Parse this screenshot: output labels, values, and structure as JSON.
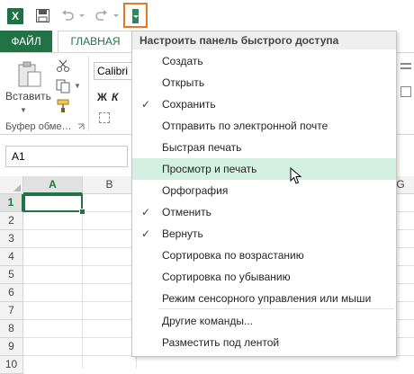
{
  "quick_access": {
    "app_logo": "X",
    "icons": [
      "excel-logo-icon",
      "save-icon",
      "undo-icon",
      "redo-icon",
      "customize-toolbar-icon"
    ],
    "highlight_color": "#e47a26"
  },
  "ribbon": {
    "tabs": [
      {
        "label": "ФАЙЛ"
      },
      {
        "label": "ГЛАВНАЯ"
      }
    ],
    "clipboard": {
      "paste_label": "Вставить",
      "group_label": "Буфер обме…"
    },
    "font": {
      "font_name": "Calibri",
      "bold_label": "Ж",
      "italic_label": "К"
    },
    "accent_color": "#217346"
  },
  "formula_bar": {
    "name_box": "A1"
  },
  "grid": {
    "columns": [
      "A",
      "B",
      "G"
    ],
    "rows": [
      "1",
      "2",
      "3",
      "4",
      "5",
      "6",
      "7",
      "8",
      "9",
      "10"
    ],
    "active_cell": "A1"
  },
  "menu": {
    "title": "Настроить панель быстрого доступа",
    "items": [
      {
        "label": "Создать",
        "checked": false
      },
      {
        "label": "Открыть",
        "checked": false
      },
      {
        "label": "Сохранить",
        "checked": true
      },
      {
        "label": "Отправить по электронной почте",
        "checked": false
      },
      {
        "label": "Быстрая печать",
        "checked": false
      },
      {
        "label": "Просмотр и печать",
        "checked": false,
        "highlighted": true
      },
      {
        "label": "Орфография",
        "checked": false
      },
      {
        "label": "Отменить",
        "checked": true
      },
      {
        "label": "Вернуть",
        "checked": true
      },
      {
        "label": "Сортировка по возрастанию",
        "checked": false
      },
      {
        "label": "Сортировка по убыванию",
        "checked": false
      },
      {
        "label": "Режим сенсорного управления или мыши",
        "checked": false
      }
    ],
    "more_commands": "Другие команды...",
    "show_below_ribbon": "Разместить под лентой",
    "check_glyph": "✓",
    "highlight_color": "#d3f0e0"
  }
}
